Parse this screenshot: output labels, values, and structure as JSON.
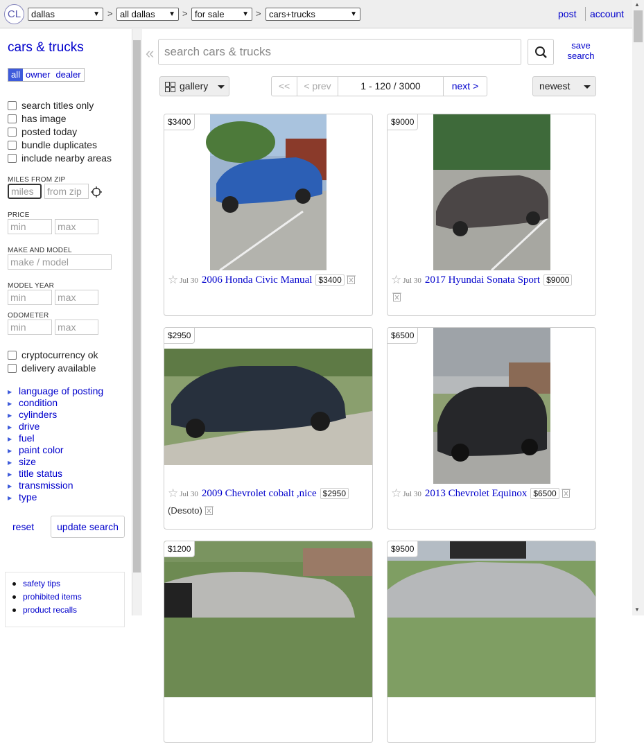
{
  "topbar": {
    "logo": "CL",
    "crumbs": [
      "dallas",
      "all dallas",
      "for sale",
      "cars+trucks"
    ],
    "post": "post",
    "account": "account"
  },
  "sidebar": {
    "title": "cars & trucks",
    "seller": [
      "all",
      "owner",
      "dealer"
    ],
    "checks": [
      "search titles only",
      "has image",
      "posted today",
      "bundle duplicates",
      "include nearby areas"
    ],
    "miles_label": "MILES FROM ZIP",
    "miles_ph": "miles",
    "zip_ph": "from zip",
    "price_label": "PRICE",
    "min_ph": "min",
    "max_ph": "max",
    "make_label": "MAKE AND MODEL",
    "make_ph": "make / model",
    "year_label": "MODEL YEAR",
    "odo_label": "ODOMETER",
    "checks2": [
      "cryptocurrency ok",
      "delivery available"
    ],
    "filters": [
      "language of posting",
      "condition",
      "cylinders",
      "drive",
      "fuel",
      "paint color",
      "size",
      "title status",
      "transmission",
      "type"
    ],
    "reset": "reset",
    "update": "update search",
    "tips": [
      "safety tips",
      "prohibited items",
      "product recalls"
    ]
  },
  "main": {
    "search_ph": "search cars & trucks",
    "save": "save search",
    "view": "gallery",
    "pager": {
      "first": "<<",
      "prev": "< prev",
      "range": "1 - 120 / 3000",
      "next": "next >"
    },
    "sort": "newest"
  },
  "listings": [
    {
      "price": "$3400",
      "date": "Jul 30",
      "title": "2006 Honda Civic Manual",
      "location": ""
    },
    {
      "price": "$9000",
      "date": "Jul 30",
      "title": "2017 Hyundai Sonata Sport",
      "location": ""
    },
    {
      "price": "$2950",
      "date": "Jul 30",
      "title": "2009 Chevrolet cobalt ,nice",
      "location": "(Desoto)"
    },
    {
      "price": "$6500",
      "date": "Jul 30",
      "title": "2013 Chevrolet Equinox",
      "location": ""
    },
    {
      "price": "$1200"
    },
    {
      "price": "$9500"
    }
  ]
}
